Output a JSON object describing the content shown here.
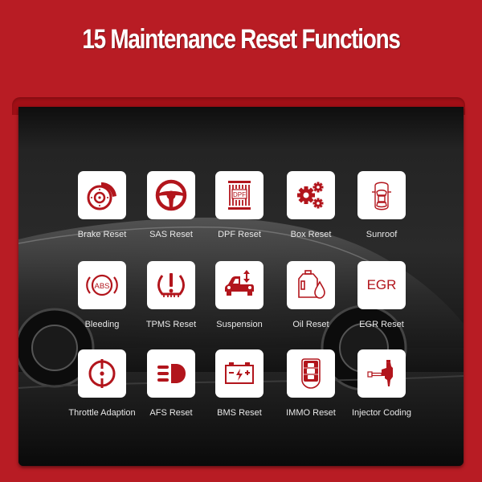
{
  "header": {
    "title": "15 Maintenance Reset Functions"
  },
  "colors": {
    "background": "#b81c24",
    "icon": "#b2151c",
    "tile": "#ffffff",
    "label": "#e8e8e8"
  },
  "functions": [
    {
      "label": "Brake Reset",
      "icon": "brake-disc-icon"
    },
    {
      "label": "SAS Reset",
      "icon": "steering-wheel-icon"
    },
    {
      "label": "DPF Reset",
      "icon": "dpf-filter-icon",
      "icon_text": "DPF"
    },
    {
      "label": "Box Reset",
      "icon": "gears-icon"
    },
    {
      "label": "Sunroof",
      "icon": "car-top-view-icon"
    },
    {
      "label": "Bleeding",
      "icon": "abs-warning-icon",
      "icon_text": "ABS"
    },
    {
      "label": "TPMS Reset",
      "icon": "tire-pressure-icon"
    },
    {
      "label": "Suspension",
      "icon": "car-suspension-icon"
    },
    {
      "label": "Oil Reset",
      "icon": "oil-can-icon"
    },
    {
      "label": "EGR Reset",
      "icon": "egr-text-icon",
      "icon_text": "EGR"
    },
    {
      "label": "Throttle Adaption",
      "icon": "throttle-icon"
    },
    {
      "label": "AFS Reset",
      "icon": "headlight-icon"
    },
    {
      "label": "BMS Reset",
      "icon": "battery-icon",
      "icon_text": "- ϟ +"
    },
    {
      "label": "IMMO Reset",
      "icon": "key-fob-icon"
    },
    {
      "label": "Injector Coding",
      "icon": "injector-icon"
    }
  ]
}
